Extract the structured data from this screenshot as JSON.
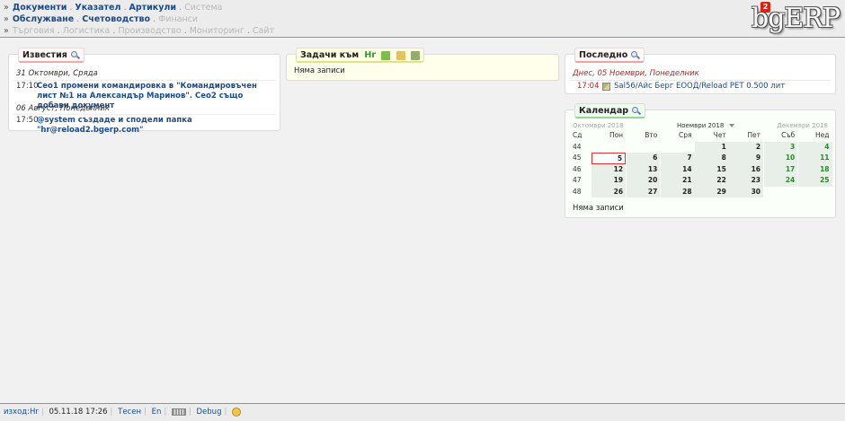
{
  "menu": {
    "row1": [
      {
        "label": "Документи",
        "on": true
      },
      {
        "label": "Указател",
        "on": true
      },
      {
        "label": "Артикули",
        "on": true
      },
      {
        "label": "Система",
        "on": false
      }
    ],
    "row2": [
      {
        "label": "Обслужване",
        "on": true
      },
      {
        "label": "Счетоводство",
        "on": true
      },
      {
        "label": "Финанси",
        "on": false
      }
    ],
    "row3": [
      {
        "label": "Търговия",
        "on": false
      },
      {
        "label": "Логистика",
        "on": false
      },
      {
        "label": "Производство",
        "on": false
      },
      {
        "label": "Мониторинг",
        "on": false
      },
      {
        "label": "Сайт",
        "on": false
      }
    ],
    "bullet": "»",
    "separator": "."
  },
  "logo": {
    "text": "bgERP",
    "badge": "2"
  },
  "news": {
    "title": "Известия",
    "days": [
      {
        "label": "31 Октомври, Сряда",
        "entries": [
          {
            "time": "17:10",
            "text": "Ceo1 промени командировка в \"Командировъчен лист №1 на Александър Маринов\". Ceo2 също добави документ"
          }
        ]
      },
      {
        "label": "06 Август, Понеделник",
        "entries": [
          {
            "time": "17:50",
            "text": "@system създаде и сподели папка \"hr@reload2.bgerp.com\""
          }
        ]
      }
    ]
  },
  "tasks": {
    "title": "Задачи към",
    "user": "Hr",
    "empty": "Няма записи"
  },
  "recent": {
    "title": "Последно",
    "date": "Днес, 05 Ноември, Понеделник",
    "time": "17:04",
    "link": "Sal56/Айс Берг ЕООД/Reload PET 0.500 лит"
  },
  "calendar": {
    "title": "Календар",
    "prev_month": "Октомври 2018",
    "current_month": "Ноември 2018",
    "next_month": "Декември 2018",
    "headers": [
      "Сд",
      "Пон",
      "Вто",
      "Сря",
      "Чет",
      "Пет",
      "Съб",
      "Нед"
    ],
    "weeks": [
      [
        "44",
        "",
        "",
        "",
        "1",
        "2",
        "3",
        "4"
      ],
      [
        "45",
        "5",
        "6",
        "7",
        "8",
        "9",
        "10",
        "11"
      ],
      [
        "46",
        "12",
        "13",
        "14",
        "15",
        "16",
        "17",
        "18"
      ],
      [
        "47",
        "19",
        "20",
        "21",
        "22",
        "23",
        "24",
        "25"
      ],
      [
        "48",
        "26",
        "27",
        "28",
        "29",
        "30",
        "",
        ""
      ]
    ],
    "today": "5",
    "empty": "Няма записи"
  },
  "footer": {
    "user": "изход:Hr",
    "datetime": "05.11.18 17:26",
    "mode": "Тесен",
    "lang": "En",
    "debug": "Debug"
  }
}
